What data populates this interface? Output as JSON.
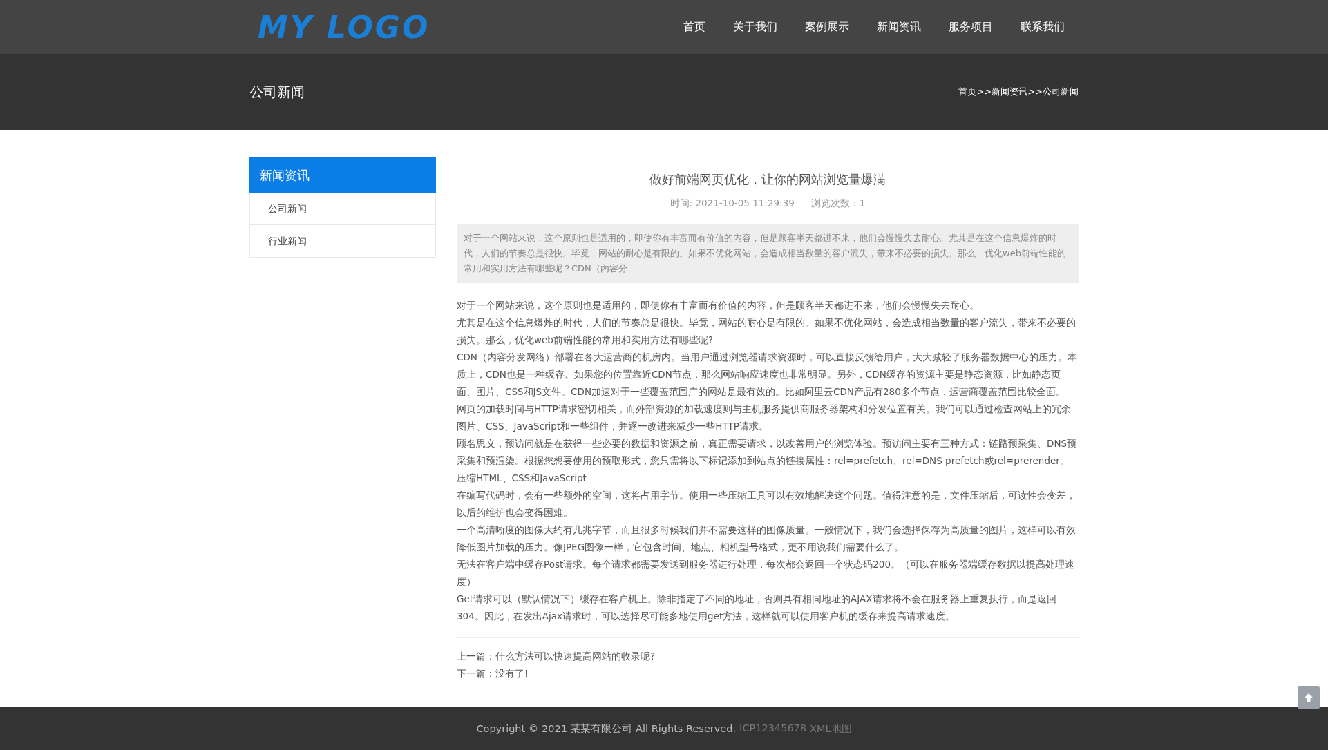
{
  "header": {
    "logo": "MY LOGO",
    "nav": [
      "首页",
      "关于我们",
      "案例展示",
      "新闻资讯",
      "服务项目",
      "联系我们"
    ]
  },
  "banner": {
    "title": "公司新闻",
    "breadcrumb": "首页>>新闻资讯>>公司新闻"
  },
  "sidebar": {
    "heading": "新闻资讯",
    "items": [
      "公司新闻",
      "行业新闻"
    ]
  },
  "article": {
    "title": "做好前端网页优化，让你的网站浏览量爆满",
    "meta": [
      "时间: 2021-10-05 11:29:39",
      "浏览次数：1"
    ],
    "summary": "对于一个网站来说，这个原则也是适用的，即使你有丰富而有价值的内容，但是顾客半天都进不来，他们会慢慢失去耐心。尤其是在这个信息爆炸的时代，人们的节奏总是很快。毕竟，网站的耐心是有限的。如果不优化网站，会造成相当数量的客户流失，带来不必要的损失。那么，优化web前端性能的常用和实用方法有哪些呢？CDN（内容分",
    "paragraphs": [
      "对于一个网站来说，这个原则也是适用的，即使你有丰富而有价值的内容，但是顾客半天都进不来，他们会慢慢失去耐心。",
      "尤其是在这个信息爆炸的时代，人们的节奏总是很快。毕竟，网站的耐心是有限的。如果不优化网站，会造成相当数量的客户流失，带来不必要的损失。那么，优化web前端性能的常用和实用方法有哪些呢?",
      "CDN（内容分发网络）部署在各大运营商的机房内。当用户通过浏览器请求资源时，可以直接反馈给用户，大大减轻了服务器数据中心的压力。本质上，CDN也是一种缓存。如果您的位置靠近CDN节点，那么网站响应速度也非常明显。另外，CDN缓存的资源主要是静态资源，比如静态页面、图片、CSS和JS文件。CDN加速对于一些覆盖范围广的网站是最有效的。比如阿里云CDN产品有280多个节点，运营商覆盖范围比较全面。",
      "网页的加载时间与HTTP请求密切相关，而外部资源的加载速度则与主机服务提供商服务器架构和分发位置有关。我们可以通过检查网站上的冗余图片、CSS、JavaScript和一些组件，并逐一改进来减少一些HTTP请求。",
      "顾名思义，预访问就是在获得一些必要的数据和资源之前，真正需要请求，以改善用户的浏览体验。预访问主要有三种方式：链路预采集、DNS预采集和预渲染。根据您想要使用的预取形式，您只需将以下标记添加到站点的链接属性：rel=prefetch、rel=DNS prefetch或rel=prerender。",
      "压缩HTML、CSS和JavaScript",
      "在编写代码时，会有一些额外的空间，这将占用字节。使用一些压缩工具可以有效地解决这个问题。值得注意的是，文件压缩后，可读性会变差，以后的维护也会变得困难。",
      "一个高清晰度的图像大约有几兆字节，而且很多时候我们并不需要这样的图像质量。一般情况下，我们会选择保存为高质量的图片，这样可以有效降低图片加载的压力。像JPEG图像一样，它包含时间、地点、相机型号格式，更不用说我们需要什么了。",
      "无法在客户端中缓存Post请求。每个请求都需要发送到服务器进行处理，每次都会返回一个状态码200。（可以在服务器端缓存数据以提高处理速度）",
      "Get请求可以（默认情况下）缓存在客户机上。除非指定了不同的地址，否则具有相同地址的AJAX请求将不会在服务器上重复执行，而是返回304。因此，在发出Ajax请求时，可以选择尽可能多地使用get方法，这样就可以使用客户机的缓存来提高请求速度。"
    ],
    "prev": {
      "label": "上一篇：",
      "title": "什么方法可以快速提高网站的收录呢?"
    },
    "next": {
      "label": "下一篇：",
      "title": "没有了!"
    }
  },
  "footer": {
    "copyright": "Copyright © 2021 某某有限公司 All Rights Reserved.",
    "links": [
      "ICP12345678",
      "XML地图"
    ]
  }
}
